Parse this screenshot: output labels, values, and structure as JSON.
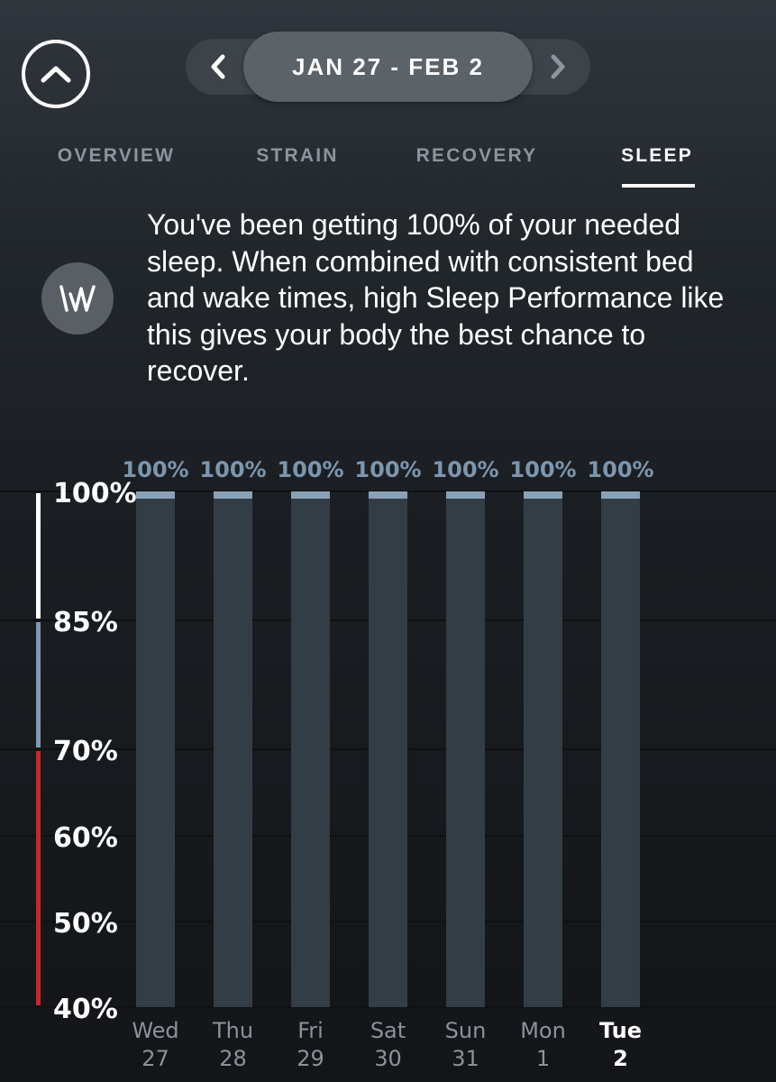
{
  "header": {
    "collapse_icon": "chevron-up-icon",
    "date_range": "JAN 27 - FEB 2",
    "prev_icon": "chevron-left-icon",
    "next_icon": "chevron-right-icon"
  },
  "tabs": [
    {
      "label": "OVERVIEW",
      "active": false
    },
    {
      "label": "STRAIN",
      "active": false
    },
    {
      "label": "RECOVERY",
      "active": false
    },
    {
      "label": "SLEEP",
      "active": true
    }
  ],
  "coach": {
    "icon": "whoop-logo-icon",
    "message": "You've been getting 100% of your needed sleep. When combined with consistent bed and wake times, high Sleep Performance like this gives your body the best chance to recover."
  },
  "colors": {
    "zone_high": "#ffffff",
    "zone_mid": "#7f99b1",
    "zone_low": "#c8262a",
    "bar_cap": "#8aa2b8",
    "bar_fill": "#333d46"
  },
  "chart_data": {
    "type": "bar",
    "categories": [
      "Wed 27",
      "Thu 28",
      "Fri 29",
      "Sat 30",
      "Sun 31",
      "Mon 1",
      "Tue 2"
    ],
    "days": [
      {
        "day": "Wed",
        "date": "27",
        "current": false
      },
      {
        "day": "Thu",
        "date": "28",
        "current": false
      },
      {
        "day": "Fri",
        "date": "29",
        "current": false
      },
      {
        "day": "Sat",
        "date": "30",
        "current": false
      },
      {
        "day": "Sun",
        "date": "31",
        "current": false
      },
      {
        "day": "Mon",
        "date": "1",
        "current": false
      },
      {
        "day": "Tue",
        "date": "2",
        "current": true
      }
    ],
    "values": [
      100,
      100,
      100,
      100,
      100,
      100,
      100
    ],
    "value_labels": [
      "100%",
      "100%",
      "100%",
      "100%",
      "100%",
      "100%",
      "100%"
    ],
    "y_ticks": [
      100,
      85,
      70,
      60,
      50,
      40
    ],
    "y_tick_labels": [
      "100%",
      "85%",
      "70%",
      "60%",
      "50%",
      "40%"
    ],
    "ylim": [
      40,
      100
    ],
    "zones": [
      {
        "from": 85,
        "to": 100,
        "color": "#ffffff"
      },
      {
        "from": 70,
        "to": 85,
        "color": "#7f99b1"
      },
      {
        "from": 40,
        "to": 70,
        "color": "#c8262a"
      }
    ],
    "grid": true
  }
}
